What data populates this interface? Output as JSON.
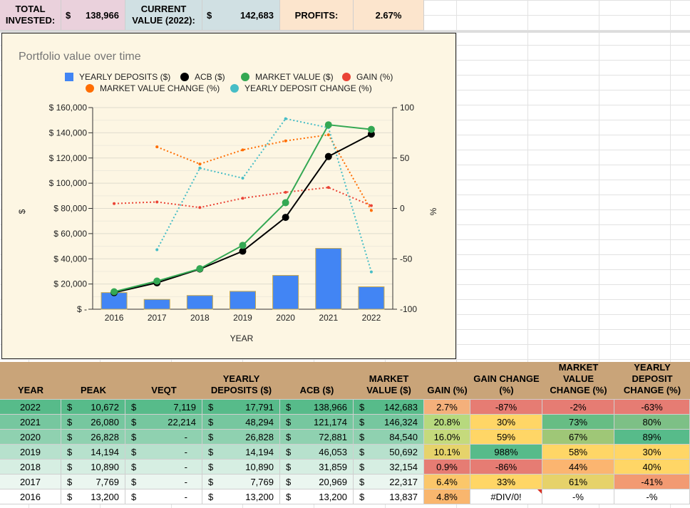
{
  "summary": {
    "total_invested_label": "TOTAL INVESTED:",
    "total_invested_currency": "$",
    "total_invested_value": "138,966",
    "current_value_label": "CURRENT VALUE (2022):",
    "current_value_currency": "$",
    "current_value_value": "142,683",
    "profits_label": "PROFITS:",
    "profits_value": "2.67%"
  },
  "chart_data": {
    "type": "combo",
    "title": "Portfolio value over time",
    "xlabel": "YEAR",
    "ylabel": "$",
    "y2label": "%",
    "categories": [
      "2016",
      "2017",
      "2018",
      "2019",
      "2020",
      "2021",
      "2022"
    ],
    "ylim": [
      0,
      160000
    ],
    "y2lim": [
      -100,
      100
    ],
    "y_ticks": [
      "$ -",
      "$ 20,000",
      "$ 40,000",
      "$ 60,000",
      "$ 80,000",
      "$ 100,000",
      "$ 120,000",
      "$ 140,000",
      "$ 160,000"
    ],
    "y2_ticks": [
      "-100",
      "-50",
      "0",
      "50",
      "100"
    ],
    "legend_position": "top",
    "series": [
      {
        "name": "YEARLY DEPOSITS ($)",
        "kind": "bar",
        "axis": "left",
        "color": "#4285f4",
        "values": [
          13200,
          7769,
          10890,
          14194,
          26828,
          48294,
          17791
        ]
      },
      {
        "name": "ACB ($)",
        "kind": "line",
        "axis": "left",
        "color": "#000000",
        "values": [
          13200,
          20969,
          31859,
          46053,
          72881,
          121174,
          138966
        ]
      },
      {
        "name": "MARKET VALUE ($)",
        "kind": "line",
        "axis": "left",
        "color": "#34a853",
        "values": [
          13837,
          22317,
          32154,
          50692,
          84540,
          146324,
          142683
        ]
      },
      {
        "name": "GAIN (%)",
        "kind": "dotted",
        "axis": "right",
        "color": "#ea4335",
        "values": [
          4.8,
          6.4,
          0.9,
          10.1,
          16.0,
          20.8,
          2.7
        ]
      },
      {
        "name": "MARKET VALUE CHANGE (%)",
        "kind": "dotted",
        "axis": "right",
        "color": "#ff6d01",
        "values": [
          null,
          61,
          44,
          58,
          67,
          73,
          -2
        ]
      },
      {
        "name": "YEARLY DEPOSIT CHANGE (%)",
        "kind": "dotted",
        "axis": "right",
        "color": "#46bdc6",
        "values": [
          null,
          -41,
          40,
          30,
          89,
          80,
          -63
        ]
      }
    ]
  },
  "table": {
    "headers": {
      "year": "YEAR",
      "peak": "PEAK",
      "veqt": "VEQT",
      "deposits": "YEARLY DEPOSITS ($)",
      "acb": "ACB ($)",
      "market": "MARKET VALUE ($)",
      "gain": "GAIN (%)",
      "gain_change": "GAIN CHANGE (%)",
      "mv_change": "MARKET VALUE CHANGE (%)",
      "dep_change": "YEARLY DEPOSIT CHANGE (%)"
    },
    "currency": "$",
    "rows": [
      {
        "year": "2022",
        "peak": "10,672",
        "veqt": "7,119",
        "deposits": "17,791",
        "acb": "138,966",
        "market": "142,683",
        "gain": "2.7%",
        "gain_change": "-87%",
        "mv_change": "-2%",
        "dep_change": "-63%"
      },
      {
        "year": "2021",
        "peak": "26,080",
        "veqt": "22,214",
        "deposits": "48,294",
        "acb": "121,174",
        "market": "146,324",
        "gain": "20.8%",
        "gain_change": "30%",
        "mv_change": "73%",
        "dep_change": "80%"
      },
      {
        "year": "2020",
        "peak": "26,828",
        "veqt": "-",
        "deposits": "26,828",
        "acb": "72,881",
        "market": "84,540",
        "gain": "16.0%",
        "gain_change": "59%",
        "mv_change": "67%",
        "dep_change": "89%"
      },
      {
        "year": "2019",
        "peak": "14,194",
        "veqt": "-",
        "deposits": "14,194",
        "acb": "46,053",
        "market": "50,692",
        "gain": "10.1%",
        "gain_change": "988%",
        "mv_change": "58%",
        "dep_change": "30%"
      },
      {
        "year": "2018",
        "peak": "10,890",
        "veqt": "-",
        "deposits": "10,890",
        "acb": "31,859",
        "market": "32,154",
        "gain": "0.9%",
        "gain_change": "-86%",
        "mv_change": "44%",
        "dep_change": "40%"
      },
      {
        "year": "2017",
        "peak": "7,769",
        "veqt": "-",
        "deposits": "7,769",
        "acb": "20,969",
        "market": "22,317",
        "gain": "6.4%",
        "gain_change": "33%",
        "mv_change": "61%",
        "dep_change": "-41%"
      },
      {
        "year": "2016",
        "peak": "13,200",
        "veqt": "-",
        "deposits": "13,200",
        "acb": "13,200",
        "market": "13,837",
        "gain": "4.8%",
        "gain_change": "#DIV/0!",
        "mv_change": "-%",
        "dep_change": "-%"
      }
    ],
    "colors": {
      "row_bg": [
        "#57bb8a",
        "#76c79f",
        "#8fd1b0",
        "#b7e1cd",
        "#d6eee2",
        "#ebf6f0",
        "#ffffff"
      ],
      "gain_bg": [
        "#f4b07b",
        "#b7d97e",
        "#c5da7c",
        "#e6d36b",
        "#e67c73",
        "#fbc76a",
        "#f9b66e"
      ],
      "gain_change_bg": [
        "#e67c73",
        "#ffd666",
        "#ffd666",
        "#57bb8a",
        "#e67c73",
        "#ffd666",
        "#ffffff"
      ],
      "mv_change_bg": [
        "#e67c73",
        "#67bd84",
        "#9fc777",
        "#ffd666",
        "#fbb570",
        "#e6d26a",
        "#ffffff"
      ],
      "dep_change_bg": [
        "#e67c73",
        "#7dc086",
        "#57bb8a",
        "#ffd666",
        "#ffd666",
        "#f29a72",
        "#ffffff"
      ]
    }
  }
}
